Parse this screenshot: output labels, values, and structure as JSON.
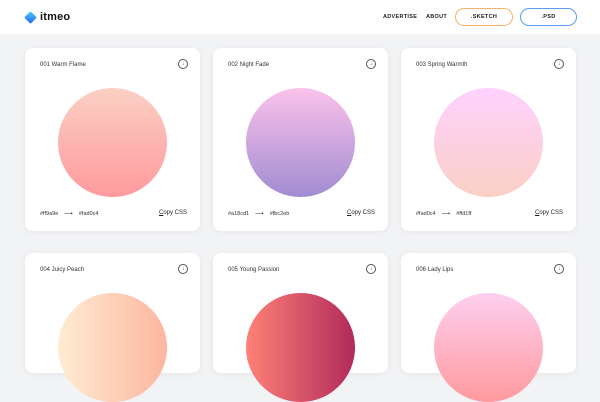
{
  "header": {
    "brand": "itmeo",
    "nav": [
      "ADVERTISE",
      "ABOUT"
    ],
    "buttons": [
      ".SKETCH",
      ".PSD"
    ]
  },
  "common": {
    "copy_label": "Copy CSS",
    "arrow": "⟶"
  },
  "cards": [
    {
      "title": "001 Warm Flame",
      "from": "#ff9a9e",
      "to": "#fad0c4",
      "from_label": "#ff9a9e",
      "to_label": "#fad0c4"
    },
    {
      "title": "002 Night Fade",
      "from": "#a18cd1",
      "to": "#fbc2eb",
      "from_label": "#a18cd1",
      "to_label": "#fbc2eb"
    },
    {
      "title": "003 Spring Warmth",
      "from": "#fad0c4",
      "to": "#ffd1ff",
      "from_label": "#fad0c4",
      "to_label": "#ffd1ff"
    },
    {
      "title": "004 Juicy Peach",
      "from": "#ffecd2",
      "to": "#fcb69f"
    },
    {
      "title": "005 Young Passion",
      "from": "#ff8177",
      "to": "#b12a5b"
    },
    {
      "title": "006 Lady Lips",
      "from": "#ff9a9e",
      "to": "#fecfef"
    }
  ]
}
